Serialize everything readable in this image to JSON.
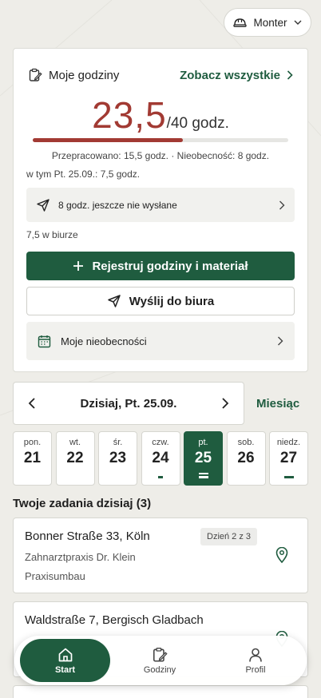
{
  "role": {
    "label": "Monter"
  },
  "hours": {
    "title": "Moje godziny",
    "see_all": "Zobacz wszystkie",
    "worked": "23,5",
    "target": "/40 godz.",
    "progress": 0.5875,
    "summary": "Przepracowano: 15,5 godz. · Nieobecność: 8 godz.",
    "today_note": "w tym Pt. 25.09.: 7,5 godz.",
    "pending": "8 godz. jeszcze nie wysłane",
    "office_note": "7,5 w biurze",
    "register_button": "Rejestruj godziny i materiał",
    "send_button": "Wyślij do biura",
    "absences": "Moje nieobecności"
  },
  "date_nav": {
    "label": "Dzisiaj, Pt. 25.09.",
    "month": "Miesiąc"
  },
  "week": [
    {
      "name": "pon.",
      "date": "21",
      "hours": 0
    },
    {
      "name": "wt.",
      "date": "22",
      "hours": 0
    },
    {
      "name": "śr.",
      "date": "23",
      "hours": 0
    },
    {
      "name": "czw.",
      "date": "24",
      "hours": "short"
    },
    {
      "name": "pt.",
      "date": "25",
      "hours": "double"
    },
    {
      "name": "sob.",
      "date": "26",
      "hours": 0
    },
    {
      "name": "niedz.",
      "date": "27",
      "hours": "long"
    }
  ],
  "tasks": {
    "title": "Twoje zadania dzisiaj (3)",
    "items": [
      {
        "address": "Bonner Straße 33, Köln",
        "client": "Zahnarztpraxis Dr. Klein",
        "project": "Praxisumbau",
        "badge": "Dzień 2 z 3"
      },
      {
        "address": "Waldstraße 7, Bergisch Gladbach"
      }
    ]
  },
  "nav": {
    "start": "Start",
    "hours": "Godziny",
    "profile": "Profil"
  },
  "colors": {
    "accent": "#1f5c3f",
    "alert": "#a23a33",
    "background": "#eeede8"
  }
}
